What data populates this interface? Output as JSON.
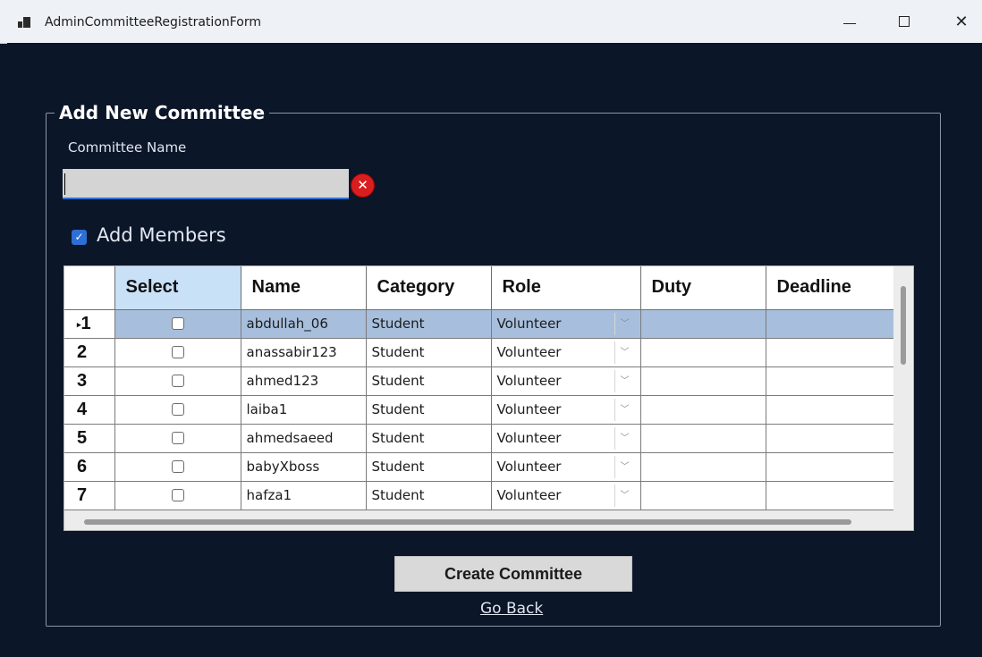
{
  "window": {
    "title": "AdminCommitteeRegistrationForm",
    "minimize_glyph": "—",
    "maximize_glyph": "☐",
    "close_glyph": "✕"
  },
  "form": {
    "group_title": "Add New Committee",
    "committee_name_label": "Committee Name",
    "committee_name_value": "",
    "error_icon": "error-icon",
    "add_members_label": "Add Members",
    "add_members_checked": true,
    "create_button": "Create Committee",
    "go_back_link": "Go Back"
  },
  "grid": {
    "columns": [
      "Select",
      "Name",
      "Category",
      "Role",
      "Duty",
      "Deadline"
    ],
    "rows": [
      {
        "index": "1",
        "selected": true,
        "name": "abdullah_06",
        "category": "Student",
        "role": "Volunteer",
        "duty": "",
        "deadline": ""
      },
      {
        "index": "2",
        "selected": false,
        "name": "anassabir123",
        "category": "Student",
        "role": "Volunteer",
        "duty": "",
        "deadline": ""
      },
      {
        "index": "3",
        "selected": false,
        "name": "ahmed123",
        "category": "Student",
        "role": "Volunteer",
        "duty": "",
        "deadline": ""
      },
      {
        "index": "4",
        "selected": false,
        "name": "laiba1",
        "category": "Student",
        "role": "Volunteer",
        "duty": "",
        "deadline": ""
      },
      {
        "index": "5",
        "selected": false,
        "name": "ahmedsaeed",
        "category": "Student",
        "role": "Volunteer",
        "duty": "",
        "deadline": ""
      },
      {
        "index": "6",
        "selected": false,
        "name": "babyXboss",
        "category": "Student",
        "role": "Volunteer",
        "duty": "",
        "deadline": ""
      },
      {
        "index": "7",
        "selected": false,
        "name": "hafza1",
        "category": "Student",
        "role": "Volunteer",
        "duty": "",
        "deadline": ""
      }
    ]
  },
  "colors": {
    "background": "#0b1628",
    "selected_row": "#a7bfdd",
    "select_header": "#c9e1f7",
    "error": "#d81e1e",
    "accent": "#2d6fd4"
  }
}
